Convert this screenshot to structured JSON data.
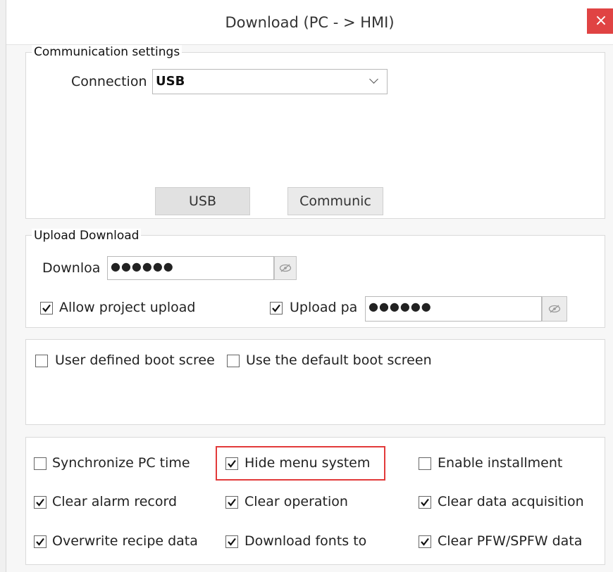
{
  "dialog": {
    "title": "Download (PC - > HMI)",
    "close_glyph": "×"
  },
  "communication": {
    "legend": "Communication settings",
    "connection_label": "Connection",
    "connection_value": "USB",
    "usb_button": "USB",
    "communic_button": "Communic"
  },
  "upload_download": {
    "legend": "Upload  Download",
    "download_label": "Downloa",
    "download_password_mask": "●●●●●●",
    "allow_project_upload": {
      "label": "Allow project upload",
      "checked": true
    },
    "upload_password": {
      "label": "Upload pa",
      "checked": true,
      "mask": "●●●●●●"
    }
  },
  "boot_screen": {
    "user_defined": {
      "label": "User defined boot scree",
      "checked": false
    },
    "use_default": {
      "label": "Use the default boot screen",
      "checked": false
    }
  },
  "options": {
    "sync_pc_time": {
      "label": "Synchronize PC time",
      "checked": false
    },
    "hide_menu_system": {
      "label": "Hide menu system",
      "checked": true
    },
    "enable_installment": {
      "label": "Enable installment",
      "checked": false
    },
    "clear_alarm_record": {
      "label": "Clear alarm record",
      "checked": true
    },
    "clear_operation": {
      "label": "Clear operation",
      "checked": true
    },
    "clear_data_acquisition": {
      "label": "Clear data acquisition",
      "checked": true
    },
    "overwrite_recipe_data": {
      "label": "Overwrite recipe data",
      "checked": true
    },
    "download_fonts_to": {
      "label": "Download fonts to",
      "checked": true
    },
    "clear_pfw_spfw_data": {
      "label": "Clear PFW/SPFW data",
      "checked": true
    }
  },
  "colors": {
    "highlight": "#e23a3a",
    "close_button": "#e04343"
  },
  "icons": {
    "eye": "eye-slash-icon",
    "check": "check-icon",
    "dropdown": "chevron-down-icon"
  }
}
